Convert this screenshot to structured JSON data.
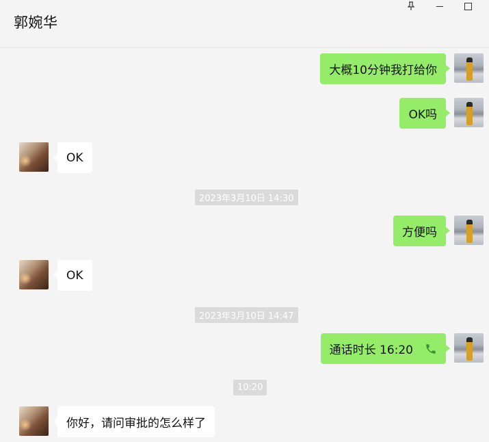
{
  "window": {
    "contact_name": "郭婉华"
  },
  "messages": [
    {
      "type": "sent",
      "text": "大概10分钟我打给你"
    },
    {
      "type": "sent",
      "text": "OK吗"
    },
    {
      "type": "received",
      "text": "OK"
    },
    {
      "type": "timestamp",
      "text": "2023年3月10日 14:30"
    },
    {
      "type": "sent",
      "text": "方便吗"
    },
    {
      "type": "received",
      "text": "OK"
    },
    {
      "type": "timestamp",
      "text": "2023年3月10日 14:47"
    },
    {
      "type": "sent_call",
      "text": "通话时长 16:20",
      "icon": "phone-icon"
    },
    {
      "type": "timestamp",
      "text": "10:20"
    },
    {
      "type": "received",
      "text": "你好，请问审批的怎么样了"
    }
  ],
  "colors": {
    "sent_bubble": "#95ec69",
    "received_bubble": "#ffffff",
    "background": "#f4f4f4"
  }
}
